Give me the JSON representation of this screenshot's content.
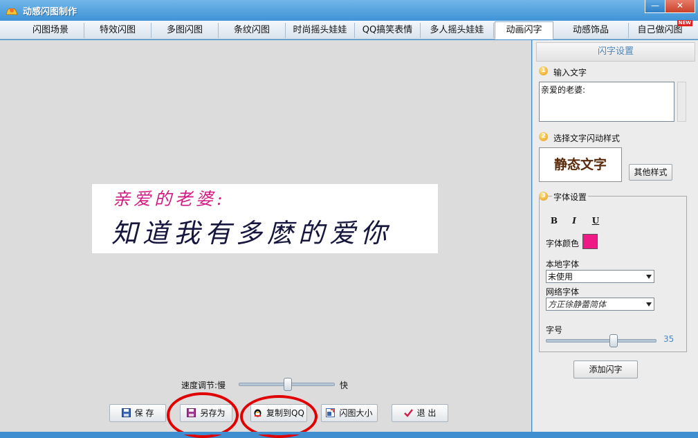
{
  "window": {
    "title": "动感闪图制作",
    "minimize_label": "—",
    "close_label": "✕"
  },
  "tabs": [
    {
      "label": "闪图场景"
    },
    {
      "label": "特效闪图"
    },
    {
      "label": "多图闪图"
    },
    {
      "label": "条纹闪图"
    },
    {
      "label": "时尚摇头娃娃"
    },
    {
      "label": "QQ搞笑表情"
    },
    {
      "label": "多人摇头娃娃"
    },
    {
      "label": "动画闪字",
      "active": true
    },
    {
      "label": "动感饰品"
    },
    {
      "label": "自己做闪图",
      "badge": "NEW"
    }
  ],
  "preview": {
    "line1": "亲爱的老婆:",
    "line2": "知道我有多麽的爱你",
    "line1_color": "#d21c84",
    "line2_color": "#16163e"
  },
  "speed": {
    "label": "速度调节:慢",
    "fast_label": "快",
    "level": 0.5
  },
  "buttons": {
    "save": "保  存",
    "save_as": "另存为",
    "copy_qq": "复制到QQ",
    "resize": "闪图大小",
    "exit": "退  出"
  },
  "panel": {
    "title": "闪字设置",
    "step1": {
      "num": "1",
      "label": "输入文字",
      "value": "亲爱的老婆:"
    },
    "step2": {
      "num": "2",
      "label": "选择文字闪动样式",
      "style_preview": "静态文字",
      "other_styles_button": "其他样式"
    },
    "step3": {
      "num": "3",
      "label": "字体设置",
      "bold": "B",
      "italic": "I",
      "underline": "U",
      "color_label": "字体颜色",
      "color": "#f01a86",
      "local_font_label": "本地字体",
      "local_font_value": "未使用",
      "web_font_label": "网络字体",
      "web_font_value": "方正徐静蕾简体",
      "size_label": "字号",
      "size_value": "35"
    },
    "add_button": "添加闪字"
  },
  "annotations": {
    "circle_color": "#e00000"
  }
}
